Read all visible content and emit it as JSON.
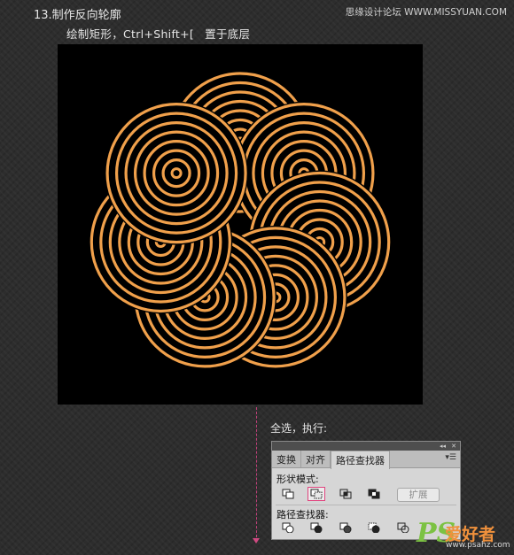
{
  "header": {
    "step_title": "13.制作反向轮廓",
    "instruction": "绘制矩形，Ctrl+Shift+[",
    "instruction_tail": "置于底层",
    "site_watermark": "思缘设计论坛 WWW.MISSYUAN.COM"
  },
  "artwork": {
    "background_color": "#000000",
    "ring_color": "#f0a04b",
    "rings": 7,
    "ring_stripes": 7
  },
  "callout": {
    "text": "全选，执行:"
  },
  "pathfinder_panel": {
    "tabs": [
      "变换",
      "对齐",
      "路径查找器"
    ],
    "active_tab": "路径查找器",
    "shape_modes_label": "形状模式:",
    "shape_modes": [
      "unite",
      "minus-front",
      "intersect",
      "exclude"
    ],
    "selected_shape_mode": "minus-front",
    "expand_label": "扩展",
    "pathfinders_label": "路径查找器:",
    "pathfinders": [
      "divide",
      "trim",
      "merge",
      "crop",
      "outline"
    ]
  },
  "watermark": {
    "logo": "PS",
    "name": "爱好者",
    "url": "www.psahz.com"
  }
}
